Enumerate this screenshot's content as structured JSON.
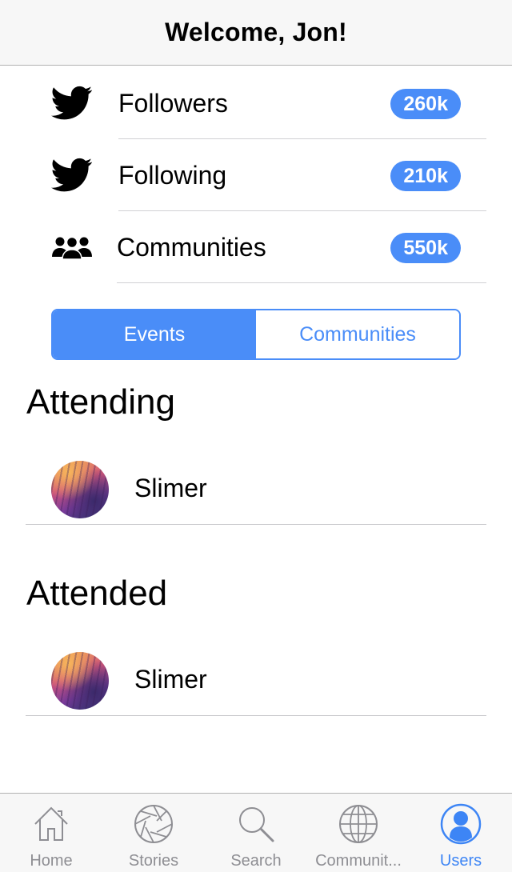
{
  "header": {
    "title": "Welcome, Jon!"
  },
  "stats": [
    {
      "icon": "twitter-bird-icon",
      "label": "Followers",
      "count": "260k"
    },
    {
      "icon": "twitter-bird-icon",
      "label": "Following",
      "count": "210k"
    },
    {
      "icon": "people-group-icon",
      "label": "Communities",
      "count": "550k"
    }
  ],
  "segmented": {
    "items": [
      "Events",
      "Communities"
    ],
    "selected": "Events"
  },
  "sections": [
    {
      "title": "Attending",
      "items": [
        {
          "name": "Slimer"
        }
      ]
    },
    {
      "title": "Attended",
      "items": [
        {
          "name": "Slimer"
        }
      ]
    }
  ],
  "tabbar": {
    "tabs": [
      {
        "label": "Home",
        "icon": "home-icon"
      },
      {
        "label": "Stories",
        "icon": "aperture-icon"
      },
      {
        "label": "Search",
        "icon": "search-icon"
      },
      {
        "label": "Communit...",
        "icon": "globe-icon"
      },
      {
        "label": "Users",
        "icon": "user-icon"
      }
    ],
    "active": "Users"
  },
  "colors": {
    "accent": "#4a8df8",
    "tab_active": "#3d85f5",
    "tab_inactive": "#8e8e93"
  }
}
